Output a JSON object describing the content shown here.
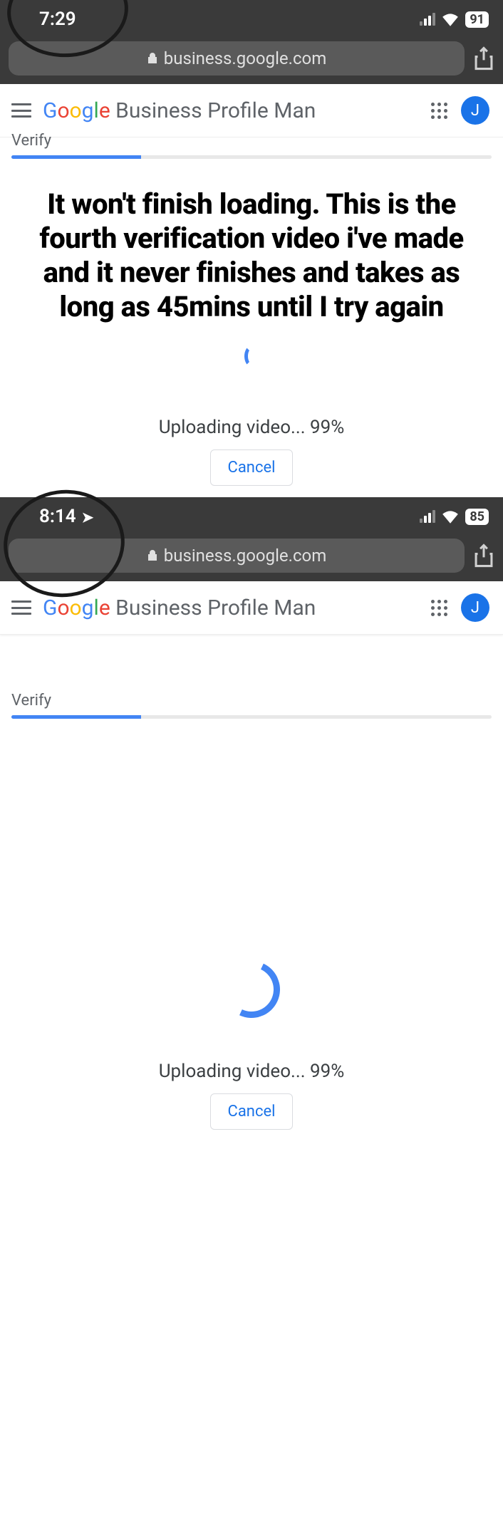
{
  "screenshot1": {
    "status": {
      "time": "7:29",
      "battery": "91"
    },
    "url": "business.google.com",
    "app_title_rest": " Business Profile Man",
    "tab_label": "Verify",
    "complaint": "It won't finish loading. This is the fourth verification video i've made and it never finishes and takes as long as 45mins until I try again",
    "upload_status": "Uploading video... 99%",
    "cancel_label": "Cancel",
    "avatar_initial": "J"
  },
  "screenshot2": {
    "status": {
      "time": "8:14",
      "battery": "85"
    },
    "url": "business.google.com",
    "app_title_rest": " Business Profile Man",
    "tab_label": "Verify",
    "upload_status": "Uploading video... 99%",
    "cancel_label": "Cancel",
    "avatar_initial": "J"
  }
}
